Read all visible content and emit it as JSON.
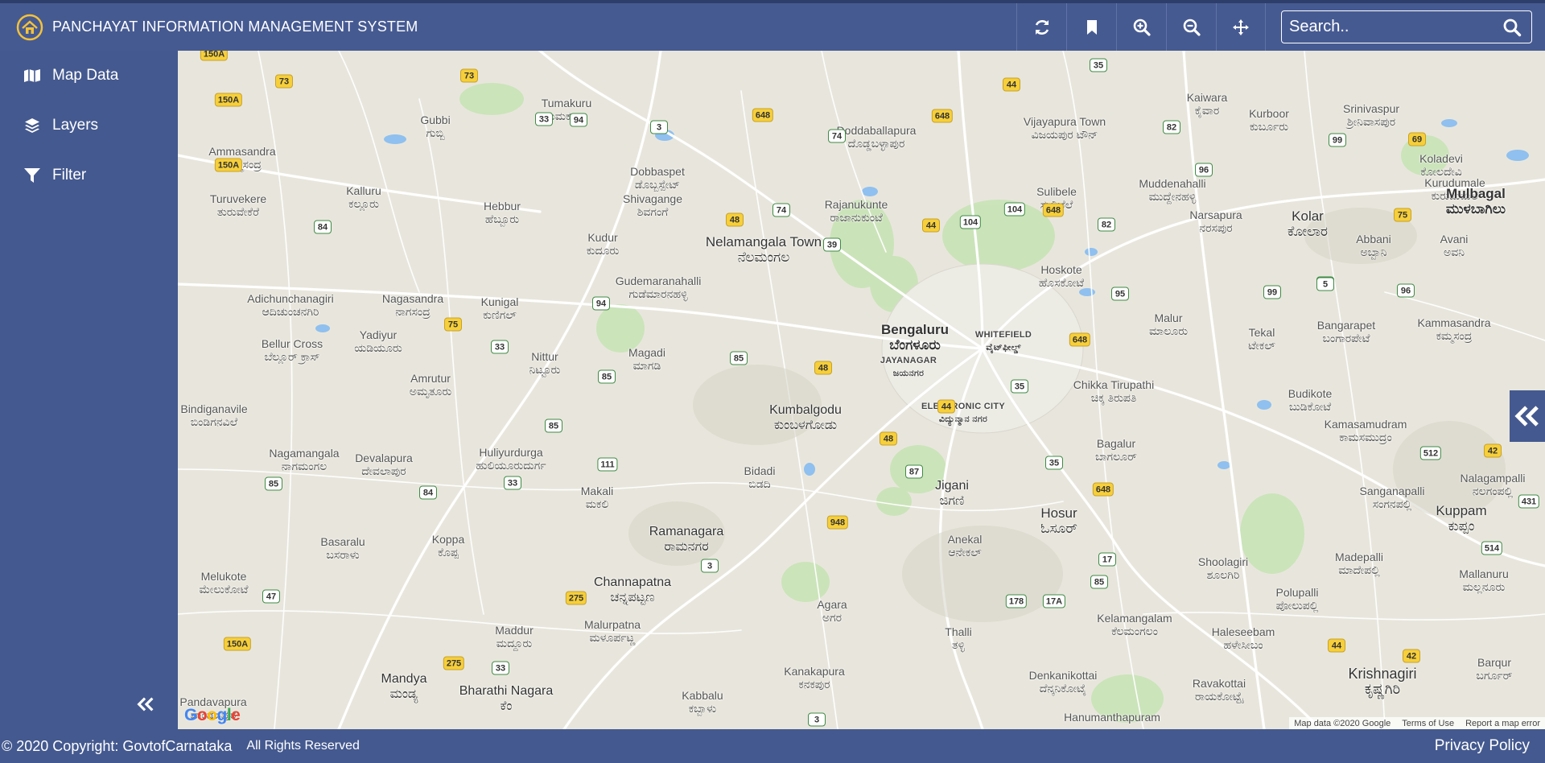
{
  "app": {
    "title": "PANCHAYAT INFORMATION MANAGEMENT SYSTEM",
    "logo_icon": "home-in-circle-icon"
  },
  "toolbar": {
    "tools": [
      {
        "name": "refresh-button",
        "icon": "refresh-icon"
      },
      {
        "name": "bookmark-button",
        "icon": "bookmark-icon"
      },
      {
        "name": "zoom-in-button",
        "icon": "zoom-in-icon"
      },
      {
        "name": "zoom-out-button",
        "icon": "zoom-out-icon"
      },
      {
        "name": "pan-button",
        "icon": "move-arrows-icon"
      }
    ],
    "search": {
      "placeholder": "Search..",
      "icon": "search-icon"
    }
  },
  "sidebar": {
    "items": [
      {
        "label": "Map Data",
        "icon": "map-icon"
      },
      {
        "label": "Layers",
        "icon": "layers-icon"
      },
      {
        "label": "Filter",
        "icon": "filter-icon"
      }
    ],
    "collapse_icon": "double-chevron-left-icon"
  },
  "map": {
    "cities": [
      {
        "en": "Bengaluru",
        "kn": "ಬೆಂಗಳೂರು"
      }
    ],
    "places": [
      {
        "en": "Tumakuru",
        "kn": "ತುಮಕೂರು"
      },
      {
        "en": "Doddaballapura",
        "kn": "ದೊಡ್ಡಬಳ್ಳಾಪುರ"
      },
      {
        "en": "Vijayapura Town",
        "kn": "ವಿಜಯಪುರ ಟೌನ್"
      },
      {
        "en": "Kaiwara",
        "kn": "ಕೈವಾರ"
      },
      {
        "en": "Kurboor",
        "kn": "ಕುರ್ಬೂರು"
      },
      {
        "en": "Srinivaspur",
        "kn": "ಶ್ರೀನಿವಾಸಪುರ"
      },
      {
        "en": "Gubbi",
        "kn": "ಗುಬ್ಬಿ"
      },
      {
        "en": "Ammasandra",
        "kn": "ಅಮ್ಮಸಂದ್ರ"
      },
      {
        "en": "Dobbaspet",
        "kn": "ಡೊಬ್ಬಸ್ಪೇಟ್"
      },
      {
        "en": "Shivagange",
        "kn": "ಶಿವಗಂಗೆ"
      },
      {
        "en": "Rajanukunte",
        "kn": "ರಾಜಾನುಕುಂಟೆ"
      },
      {
        "en": "Sulibele",
        "kn": "ಸುಲಿಬೆಲೆ"
      },
      {
        "en": "Muddenahalli",
        "kn": "ಮುದ್ದೇನಹಳ್ಳಿ"
      },
      {
        "en": "Koladevi",
        "kn": "ಕೋಲದೇವಿ"
      },
      {
        "en": "Kurudumale",
        "kn": "ಕುರುಡುಮಲೆ"
      },
      {
        "en": "Mulbagal",
        "kn": "ಮುಳಬಾಗಿಲು"
      },
      {
        "en": "Turuvekere",
        "kn": "ತುರುವೇಕೆರೆ"
      },
      {
        "en": "Kalluru",
        "kn": "ಕಲ್ಲೂರು"
      },
      {
        "en": "Hebbur",
        "kn": "ಹೆಬ್ಬೂರು"
      },
      {
        "en": "Kudur",
        "kn": "ಕುದೂರು"
      },
      {
        "en": "Nelamangala Town",
        "kn": "ನೆಲಮಂಗಲ"
      },
      {
        "en": "Narsapura",
        "kn": "ನರಸಪುರ"
      },
      {
        "en": "Kolar",
        "kn": "ಕೋಲಾರ"
      },
      {
        "en": "Abbani",
        "kn": "ಅಬ್ಬಾನಿ"
      },
      {
        "en": "Avani",
        "kn": "ಅವನಿ"
      },
      {
        "en": "Gudemaranahalli",
        "kn": "ಗುಡೆಮಾರನಹಳ್ಳಿ"
      },
      {
        "en": "Hoskote",
        "kn": "ಹೊಸಕೋಟೆ"
      },
      {
        "en": "Adichunchanagiri",
        "kn": "ಆದಿಚುಂಚನಗಿರಿ"
      },
      {
        "en": "Nagasandra",
        "kn": "ನಾಗಸಂದ್ರ"
      },
      {
        "en": "Kunigal",
        "kn": "ಕುಣಿಗಲ್"
      },
      {
        "en": "Malur",
        "kn": "ಮಾಲೂರು"
      },
      {
        "en": "Tekal",
        "kn": "ಟೇಕಲ್"
      },
      {
        "en": "Bangarapet",
        "kn": "ಬಂಗಾರಪೇಟೆ"
      },
      {
        "en": "Kammasandra",
        "kn": "ಕಮ್ಮಸಂದ್ರ"
      },
      {
        "en": "Bellur Cross",
        "kn": "ಬೆಲ್ಲೂರ್ ಕ್ರಾಸ್"
      },
      {
        "en": "Yadiyur",
        "kn": "ಯಡಿಯೂರು"
      },
      {
        "en": "Nittur",
        "kn": "ನಿಟ್ಟೂರು"
      },
      {
        "en": "Magadi",
        "kn": "ಮಾಗಡಿ"
      },
      {
        "en": "Amrutur",
        "kn": "ಅಮೃತೂರು"
      },
      {
        "en": "Chikka Tirupathi",
        "kn": "ಚಿಕ್ಕ ತಿರುಪತಿ"
      },
      {
        "en": "Budikote",
        "kn": "ಬುಡಿಕೋಟೆ"
      },
      {
        "en": "Kamasamudram",
        "kn": "ಕಾಮಸಮುದ್ರಂ"
      },
      {
        "en": "Bindiganavile",
        "kn": "ಬಿಂಡಿಗನವಿಲೆ"
      },
      {
        "en": "Kumbalgodu",
        "kn": "ಕುಂಬಳಗೋಡು"
      },
      {
        "en": "Bagalur",
        "kn": "ಬಾಗಲೂರ್"
      },
      {
        "en": "Nagamangala",
        "kn": "ನಾಗಮಂಗಲ"
      },
      {
        "en": "Devalapura",
        "kn": "ದೇವಲಾಪುರ"
      },
      {
        "en": "Huliyurdurga",
        "kn": "ಹುಲಿಯೂರುದುರ್ಗ"
      },
      {
        "en": "Bidadi",
        "kn": "ಬಿಡದಿ"
      },
      {
        "en": "Jigani",
        "kn": "ಜಿಗಣಿ"
      },
      {
        "en": "Nalagampalli",
        "kn": "ನಲಗಂಪಲ್ಲಿ"
      },
      {
        "en": "Makali",
        "kn": "ಮಕಲಿ"
      },
      {
        "en": "Hosur",
        "kn": "ಓಸೂರ್"
      },
      {
        "en": "Sanganapalli",
        "kn": "ಸಂಗನಪಲ್ಲಿ"
      },
      {
        "en": "Kuppam",
        "kn": "ಕುಪ್ಪಂ"
      },
      {
        "en": "Basaralu",
        "kn": "ಬಸರಾಳು"
      },
      {
        "en": "Koppa",
        "kn": "ಕೊಪ್ಪ"
      },
      {
        "en": "Ramanagara",
        "kn": "ರಾಮನಗರ"
      },
      {
        "en": "Anekal",
        "kn": "ಆನೇಕಲ್"
      },
      {
        "en": "Melukote",
        "kn": "ಮೇಲುಕೋಟೆ"
      },
      {
        "en": "Channapatna",
        "kn": "ಚನ್ನಪಟ್ಟಣ"
      },
      {
        "en": "Shoolagiri",
        "kn": "ಶೂಲಗಿರಿ"
      },
      {
        "en": "Madepalli",
        "kn": "ಮಾದೇಪಲ್ಲಿ"
      },
      {
        "en": "Mallanuru",
        "kn": "ಮಲ್ಲನೂರು"
      },
      {
        "en": "Polupalli",
        "kn": "ಪೋಲುಪಲ್ಲಿ"
      },
      {
        "en": "Agara",
        "kn": "ಅಗರ"
      },
      {
        "en": "Maddur",
        "kn": "ಮದ್ದೂರು"
      },
      {
        "en": "Malurpatna",
        "kn": "ಮಳೂರ್ಪಟ್ಣ"
      },
      {
        "en": "Thalli",
        "kn": "ತಳ್ಳಿ"
      },
      {
        "en": "Kelamangalam",
        "kn": "ಕೆಲಮಂಗಲಂ"
      },
      {
        "en": "Haleseebam",
        "kn": "ಹಳೇಸೀಬಂ"
      },
      {
        "en": "Mandya",
        "kn": "ಮಂಡ್ಯ"
      },
      {
        "en": "Kanakapura",
        "kn": "ಕನಕಪುರ"
      },
      {
        "en": "Denkanikottai",
        "kn": "ದೆನ್ಕನಿಕೋಟೈ"
      },
      {
        "en": "Krishnagiri",
        "kn": "ಕೃಷ್ಣಗಿರಿ"
      },
      {
        "en": "Barqur",
        "kn": "ಬರ್ಗೂರ್"
      },
      {
        "en": "Pandavapura",
        "kn": "ಪಾಂಡವಪುರ"
      },
      {
        "en": "Bharathi Nagara",
        "kn": "ಕೆಂ"
      },
      {
        "en": "Kabbalu",
        "kn": "ಕಬ್ಬಾಳು"
      },
      {
        "en": "Ravakottai",
        "kn": "ರಾಯಕೋಟ್ಟೈ"
      },
      {
        "en": "Hanumanthapuram",
        "kn": ""
      }
    ],
    "districts": [
      {
        "en": "JAYANAGAR",
        "kn": "ಜಯನಗರ"
      },
      {
        "en": "WHITEFIELD",
        "kn": "ವೈಟ್‌ಫೀಲ್ಡ್"
      },
      {
        "en": "ELECTRONIC CITY",
        "kn": "ವಿದ್ಯುನ್ಮಾನ ನಗರ"
      }
    ],
    "highways": {
      "nh": [
        "150A",
        "73",
        "150A",
        "150A",
        "73",
        "648",
        "648",
        "44",
        "69",
        "48",
        "44",
        "648",
        "75",
        "75",
        "648",
        "48",
        "44",
        "48",
        "648",
        "42",
        "275",
        "150A",
        "275",
        "44",
        "42",
        "948"
      ],
      "sh": [
        "33",
        "94",
        "3",
        "74",
        "35",
        "82",
        "99",
        "96",
        "84",
        "74",
        "39",
        "104",
        "104",
        "82",
        "94",
        "99",
        "5",
        "96",
        "95",
        "33",
        "85",
        "85",
        "35",
        "85",
        "111",
        "33",
        "35",
        "87",
        "85",
        "84",
        "512",
        "431",
        "514",
        "17",
        "85",
        "3",
        "47",
        "178",
        "17A",
        "33",
        "3",
        "5"
      ]
    },
    "google_logo": "Google",
    "attribution": [
      "Map data ©2020 Google",
      "Terms of Use",
      "Report a map error"
    ],
    "expand_icon": "double-chevron-left-icon"
  },
  "footer": {
    "copyright": "© 2020 Copyright: GovtofCarnataka",
    "rights": "All Rights Reserved",
    "privacy": "Privacy Policy"
  },
  "colors": {
    "brand": "#44598f",
    "map_land": "#e8e6dc",
    "park": "#c6e3b4",
    "water": "#8fc0ef",
    "highway_shield": "#f6cf3a"
  }
}
